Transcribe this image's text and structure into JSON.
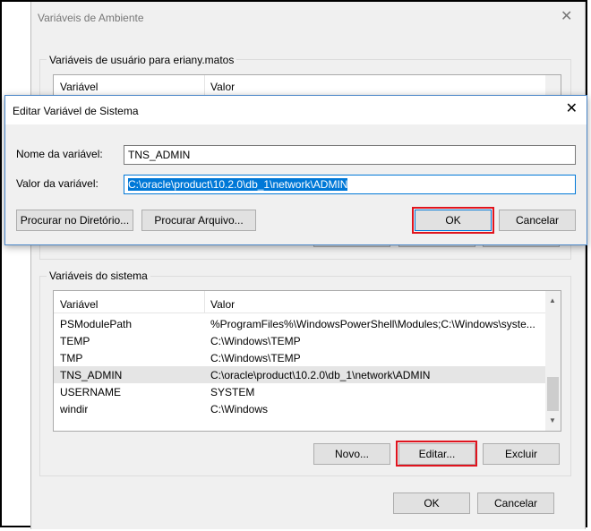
{
  "background_dialog": {
    "title": "Variáveis de Ambiente",
    "user_group_label": "Variáveis de usuário para eriany.matos",
    "user_columns": [
      "Variável",
      "Valor"
    ],
    "system_group_label": "Variáveis do sistema",
    "system_columns": [
      "Variável",
      "Valor"
    ],
    "system_rows": [
      {
        "name": "PSModulePath",
        "value": "%ProgramFiles%\\WindowsPowerShell\\Modules;C:\\Windows\\syste..."
      },
      {
        "name": "TEMP",
        "value": "C:\\Windows\\TEMP"
      },
      {
        "name": "TMP",
        "value": "C:\\Windows\\TEMP"
      },
      {
        "name": "TNS_ADMIN",
        "value": "C:\\oracle\\product\\10.2.0\\db_1\\network\\ADMIN"
      },
      {
        "name": "USERNAME",
        "value": "SYSTEM"
      },
      {
        "name": "windir",
        "value": "C:\\Windows"
      }
    ],
    "system_buttons": {
      "new": "Novo...",
      "edit": "Editar...",
      "delete": "Excluir"
    },
    "footer_buttons": {
      "ok": "OK",
      "cancel": "Cancelar"
    }
  },
  "edit_dialog": {
    "title": "Editar Variável de Sistema",
    "name_label": "Nome da variável:",
    "name_value": "TNS_ADMIN",
    "value_label": "Valor da variável:",
    "value_value": "C:\\oracle\\product\\10.2.0\\db_1\\network\\ADMIN",
    "browse_dir": "Procurar no Diretório...",
    "browse_file": "Procurar Arquivo...",
    "ok": "OK",
    "cancel": "Cancelar"
  },
  "colors": {
    "highlight": "#e0141e",
    "accent": "#0078d7"
  },
  "icons": {
    "close": "close-icon",
    "scroll_up": "chevron-up-icon",
    "scroll_down": "chevron-down-icon"
  }
}
